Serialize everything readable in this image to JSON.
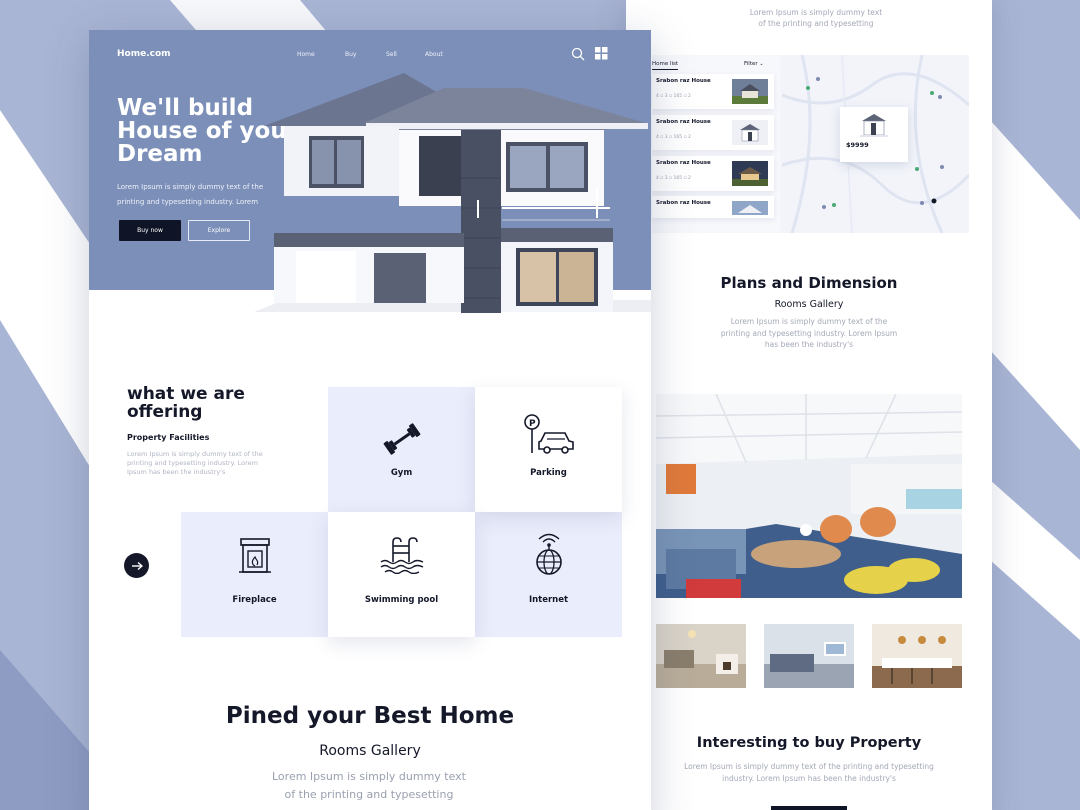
{
  "colors": {
    "accent": "#7b8fb8",
    "dark": "#0f1426",
    "tile_blue": "#eaedfb",
    "bg_stripe": "#a9b5d4"
  },
  "left": {
    "brand": "Home.com",
    "nav": [
      "Home",
      "Buy",
      "Sell",
      "About"
    ],
    "hero": {
      "title_lines": [
        "We'll build",
        "House of your",
        "Dream"
      ],
      "subtitle_lines": [
        "Lorem Ipsum is simply dummy text of the",
        "printing and typesetting industry. Lorem"
      ],
      "buy_label": "Buy now",
      "explore_label": "Explore"
    },
    "offering": {
      "title_lines": [
        "what we are",
        "offering"
      ],
      "subtitle": "Property Facilities",
      "desc_lines": [
        "Lorem Ipsum is simply dummy text of the",
        "printing and typesetting industry. Lorem",
        "Ipsum has been the industry's"
      ]
    },
    "facilities": [
      "Gym",
      "Parking",
      "Fireplace",
      "Swimming pool",
      "Internet"
    ],
    "best": {
      "title": "Pined your Best Home",
      "subtitle": "Rooms Gallery",
      "desc_lines": [
        "Lorem Ipsum is simply dummy text",
        "of the printing and typesetting"
      ]
    }
  },
  "right": {
    "top_desc_lines": [
      "Lorem Ipsum is simply dummy text",
      "of the printing and typesetting"
    ],
    "map": {
      "list_title": "Home list",
      "filter_label": "Filter",
      "items": [
        {
          "name": "Srabon raz House",
          "meta": "4 ▫  3 ▫  165 ▫  2"
        },
        {
          "name": "Srabon raz House",
          "meta": "4 ▫  3 ▫  165 ▫  2"
        },
        {
          "name": "Srabon raz House",
          "meta": "4 ▫  3 ▫  165 ▫  2"
        },
        {
          "name": "Srabon raz House",
          "meta": ""
        }
      ],
      "popup_price": "$9999"
    },
    "plans": {
      "title": "Plans and Dimension",
      "subtitle": "Rooms Gallery",
      "desc_lines": [
        "Lorem Ipsum is simply dummy text of the",
        "printing and typesetting industry. Lorem Ipsum",
        "has been the industry's"
      ]
    },
    "buy": {
      "title": "Interesting to buy Property",
      "desc_lines": [
        "Lorem Ipsum is simply dummy text of the printing and typesetting",
        "industry. Lorem Ipsum has been the industry's"
      ]
    }
  }
}
